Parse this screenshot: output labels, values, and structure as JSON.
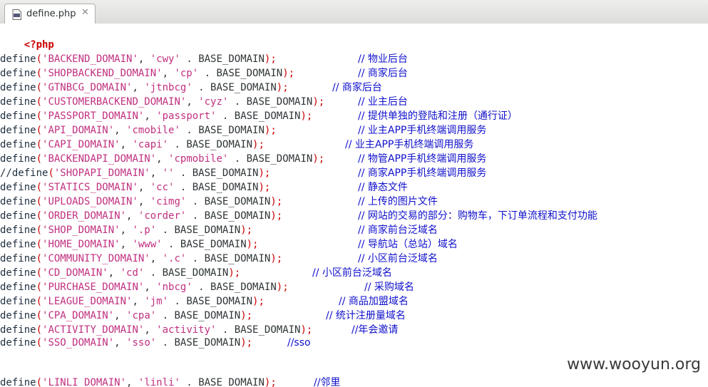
{
  "tab": {
    "filename": "define.php",
    "close": "✕",
    "icon": "php-file-icon"
  },
  "editor": {
    "open_tag": "<?php",
    "lines": [
      {
        "fn": "define",
        "name": "'BACKEND_DOMAIN'",
        "val": "'cwy'",
        "base": "BASE_DOMAIN",
        "comment": "// 物业后台"
      },
      {
        "fn": "define",
        "name": "'SHOPBACKEND_DOMAIN'",
        "val": "'cp'",
        "base": "BASE_DOMAIN",
        "comment": "// 商家后台"
      },
      {
        "fn": "define",
        "name": "'GTNBCG_DOMAIN'",
        "val": "'jtnbcg'",
        "base": "BASE_DOMAIN",
        "comment": "// 商家后台"
      },
      {
        "fn": "define",
        "name": "'CUSTOMERBACKEND_DOMAIN'",
        "val": "'cyz'",
        "base": "BASE_DOMAIN",
        "comment": "// 业主后台"
      },
      {
        "fn": "define",
        "name": "'PASSPORT_DOMAIN'",
        "val": "'passport'",
        "base": "BASE_DOMAIN",
        "comment": "// 提供单独的登陆和注册（通行证）"
      },
      {
        "fn": "define",
        "name": "'API_DOMAIN'",
        "val": "'cmobile'",
        "base": "BASE_DOMAIN",
        "comment": "// 业主APP手机终端调用服务"
      },
      {
        "fn": "define",
        "name": "'CAPI_DOMAIN'",
        "val": "'capi'",
        "base": "BASE_DOMAIN",
        "comment": "// 业主APP手机终端调用服务"
      },
      {
        "fn": "define",
        "name": "'BACKENDAPI_DOMAIN'",
        "val": "'cpmobile'",
        "base": "BASE_DOMAIN",
        "comment": "// 物管APP手机终端调用服务"
      },
      {
        "fn": "//define",
        "name": "'SHOPAPI_DOMAIN'",
        "val": "''",
        "base": "BASE_DOMAIN",
        "comment": "// 商家APP手机终端调用服务"
      },
      {
        "fn": "define",
        "name": "'STATICS_DOMAIN'",
        "val": "'cc'",
        "base": "BASE_DOMAIN",
        "comment": "// 静态文件"
      },
      {
        "fn": "define",
        "name": "'UPLOADS_DOMAIN'",
        "val": "'cimg'",
        "base": "BASE_DOMAIN",
        "comment": "// 上传的图片文件"
      },
      {
        "fn": "define",
        "name": "'ORDER_DOMAIN'",
        "val": "'corder'",
        "base": "BASE_DOMAIN",
        "comment": "// 网站的交易的部分：购物车，下订单流程和支付功能"
      },
      {
        "fn": "define",
        "name": "'SHOP_DOMAIN'",
        "val": "'.p'",
        "base": "BASE_DOMAIN",
        "comment": "// 商家前台泛域名"
      },
      {
        "fn": "define",
        "name": "'HOME_DOMAIN'",
        "val": "'www'",
        "base": "BASE_DOMAIN",
        "comment": "// 导航站（总站）域名"
      },
      {
        "fn": "define",
        "name": "'COMMUNITY_DOMAIN'",
        "val": "'.c'",
        "base": "BASE_DOMAIN",
        "comment": "// 小区前台泛域名"
      },
      {
        "fn": "define",
        "name": "'CD_DOMAIN'",
        "val": "'cd'",
        "base": "BASE_DOMAIN",
        "comment": "// 小区前台泛域名"
      },
      {
        "fn": "define",
        "name": "'PURCHASE_DOMAIN'",
        "val": "'nbcg'",
        "base": "BASE_DOMAIN",
        "comment": "// 采购域名"
      },
      {
        "fn": "define",
        "name": "'LEAGUE_DOMAIN'",
        "val": "'jm'",
        "base": "BASE_DOMAIN",
        "comment": "// 商品加盟域名"
      },
      {
        "fn": "define",
        "name": "'CPA_DOMAIN'",
        "val": "'cpa'",
        "base": "BASE_DOMAIN",
        "comment": "// 统计注册量域名"
      },
      {
        "fn": "define",
        "name": "'ACTIVITY_DOMAIN'",
        "val": "'activity'",
        "base": "BASE_DOMAIN",
        "comment": "//年会邀请"
      },
      {
        "fn": "define",
        "name": "'SSO_DOMAIN'",
        "val": "'sso'",
        "base": "BASE_DOMAIN",
        "comment": "//sso"
      },
      {
        "fn": "define",
        "name": "'LINLI_DOMAIN'",
        "val": "'linli'",
        "base": "BASE_DOMAIN",
        "comment": "//邻里"
      }
    ]
  },
  "watermark": "www.wooyun.org",
  "colors": {
    "string": "#c0307f",
    "comment": "#1010cc",
    "keyword": "#cc0000"
  }
}
